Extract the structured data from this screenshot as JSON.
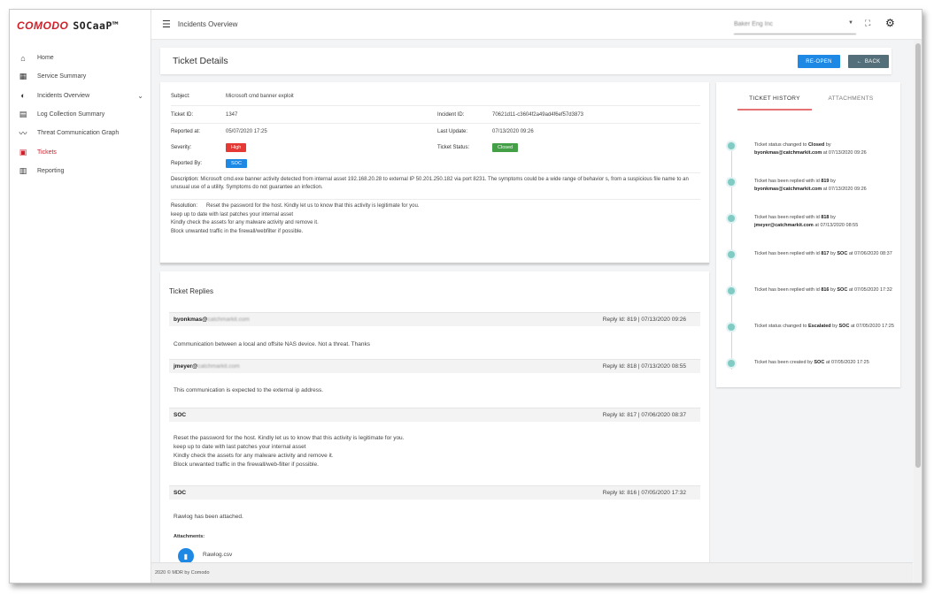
{
  "brand": {
    "name": "COMODO",
    "product": "SOCaaP™"
  },
  "sidebar": {
    "items": [
      {
        "label": "Home",
        "icon": "home-icon",
        "glyph": "⌂"
      },
      {
        "label": "Service Summary",
        "icon": "grid-icon",
        "glyph": "▦"
      },
      {
        "label": "Incidents Overview",
        "icon": "pie-chart-icon",
        "glyph": "◐"
      },
      {
        "label": "Log Collection Summary",
        "icon": "log-icon",
        "glyph": "▤"
      },
      {
        "label": "Threat Communication Graph",
        "icon": "trend-icon",
        "glyph": "〰"
      },
      {
        "label": "Tickets",
        "icon": "ticket-icon",
        "glyph": "▣"
      },
      {
        "label": "Reporting",
        "icon": "report-icon",
        "glyph": "▥"
      }
    ]
  },
  "topbar": {
    "title": "Incidents Overview",
    "org": "Baker Eng Inc"
  },
  "header": {
    "title": "Ticket Details",
    "reopen_label": "RE-OPEN",
    "back_label": "BACK"
  },
  "ticket": {
    "subject_label": "Subject:",
    "subject": "Microsoft cmd banner exploit",
    "ticket_id_label": "Ticket ID:",
    "ticket_id": "1347",
    "incident_id_label": "Incident ID:",
    "incident_id": "70621d11-c3604f2a49ad4f6ef57d3873",
    "reported_at_label": "Reported at:",
    "reported_at": "05/07/2020 17:25",
    "last_update_label": "Last Update:",
    "last_update": "07/13/2020 09:26",
    "severity_label": "Severity:",
    "severity": "High",
    "status_label": "Ticket Status:",
    "status": "Closed",
    "reported_by_label": "Reported By:",
    "reported_by": "SOC",
    "description_label": "Description:",
    "description": "Microsoft cmd.exe banner activity detected from internal asset 192.168.20.28 to external IP 50.201.250.182 via port 8231. The symptoms could be a wide range of behavior s, from a suspicious file name to an unusual use of a utility. Symptoms do not guarantee an infection.",
    "resolution_label": "Resolution:",
    "resolution": [
      "Reset the password for the host. Kindly let us to know that this activity is legitimate for you.",
      "keep up to date with last patches your internal asset",
      "Kindly check the assets for any malware activity and remove it.",
      "Block unwanted traffic in the firewall/webfilter if possible."
    ]
  },
  "replies": {
    "title": "Ticket Replies",
    "items": [
      {
        "author": "byonkmas@",
        "author_masked": "catchmarkit.com",
        "meta": "Reply Id: 819 | 07/13/2020 09:26",
        "body": [
          "Communication between a local and offsite NAS device. Not a threat. Thanks"
        ]
      },
      {
        "author": "jmeyer@",
        "author_masked": "catchmarkit.com",
        "meta": "Reply Id: 818 | 07/13/2020 08:55",
        "body": [
          "This communication is expected to the external ip address."
        ]
      },
      {
        "author": "SOC",
        "author_masked": "",
        "meta": "Reply Id: 817 | 07/06/2020 08:37",
        "body": [
          "Reset the password for the host. Kindly let us to know that this activity is legitimate for you.",
          "keep up to date with last patches your internal asset",
          "Kindly check the assets for any malware activity and remove it.",
          "Block unwanted traffic in the firewall/web-filter if possible."
        ]
      },
      {
        "author": "SOC",
        "author_masked": "",
        "meta": "Reply Id: 816 | 07/05/2020 17:32",
        "body": [
          "Rawlog has been attached."
        ]
      }
    ],
    "attachments_label": "Attachments:",
    "attachment_name": "Rawlog.csv"
  },
  "history": {
    "tab_history": "TICKET HISTORY",
    "tab_attachments": "ATTACHMENTS",
    "events": [
      {
        "pre": "Ticket status changed to ",
        "bold1": "Closed",
        "mid": " by ",
        "bold2": "byonkmas@catchmarkit.com",
        "post": " at 07/13/2020 09:26"
      },
      {
        "pre": "Ticket has been replied with id ",
        "bold1": "819",
        "mid": " by ",
        "bold2": "byonkmas@catchmarkit.com",
        "post": " at 07/13/2020 09:26"
      },
      {
        "pre": "Ticket has been replied with id ",
        "bold1": "818",
        "mid": " by ",
        "bold2": "jmeyer@catchmarkit.com",
        "post": " at 07/13/2020 08:55"
      },
      {
        "pre": "Ticket has been replied with id ",
        "bold1": "817",
        "mid": " by ",
        "bold2": "SOC",
        "post": " at 07/06/2020 08:37"
      },
      {
        "pre": "Ticket has been replied with id ",
        "bold1": "816",
        "mid": " by ",
        "bold2": "SOC",
        "post": " at 07/05/2020 17:32"
      },
      {
        "pre": "Ticket status changed to ",
        "bold1": "Escalated",
        "mid": " by ",
        "bold2": "SOC",
        "post": " at 07/05/2020 17:25"
      },
      {
        "pre": "Ticket has been created by ",
        "bold1": "SOC",
        "mid": " at 07/05/2020 17:25",
        "bold2": "",
        "post": ""
      }
    ]
  },
  "footer": {
    "text": "2020 © MDR by Comodo"
  },
  "colors": {
    "brand_red": "#d0202a",
    "primary_blue": "#1e88e5",
    "back_gray": "#546e7a",
    "high_red": "#e53935",
    "closed_green": "#43a047",
    "timeline_teal": "#80cbc4"
  }
}
